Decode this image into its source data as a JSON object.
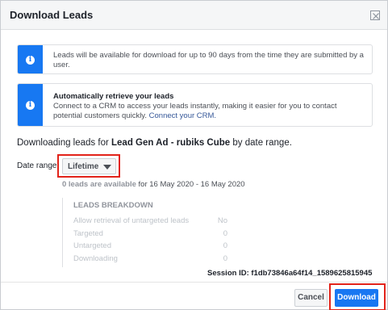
{
  "dialog": {
    "title": "Download Leads",
    "close_icon": "close-icon"
  },
  "notices": {
    "availability": "Leads will be available for download for up to 90 days from the time they are submitted by a user.",
    "crm_title": "Automatically retrieve your leads",
    "crm_text": "Connect to a CRM to access your leads instantly, making it easier for you to contact potential customers quickly.",
    "crm_link": "Connect your CRM.",
    "icon": "info-icon"
  },
  "downloading": {
    "prefix": "Downloading leads for",
    "ad_name": "Lead Gen Ad - rubiks Cube",
    "suffix": "by date range."
  },
  "date_range": {
    "label": "Date range",
    "selected": "Lifetime"
  },
  "availability_line": {
    "count": "0 leads are available",
    "range": "for 16 May 2020 - 16 May 2020"
  },
  "breakdown": {
    "title": "LEADS BREAKDOWN",
    "rows": [
      {
        "label": "Allow retrieval of untargeted leads",
        "value": "No"
      },
      {
        "label": "Targeted",
        "value": "0"
      },
      {
        "label": "Untargeted",
        "value": "0"
      },
      {
        "label": "Downloading",
        "value": "0"
      }
    ]
  },
  "session": {
    "text": "Session ID: f1db73846a64f14_1589625815945"
  },
  "footer": {
    "cancel_label": "Cancel",
    "download_label": "Download"
  },
  "colors": {
    "accent": "#1877f2",
    "highlight": "#e2231a"
  }
}
